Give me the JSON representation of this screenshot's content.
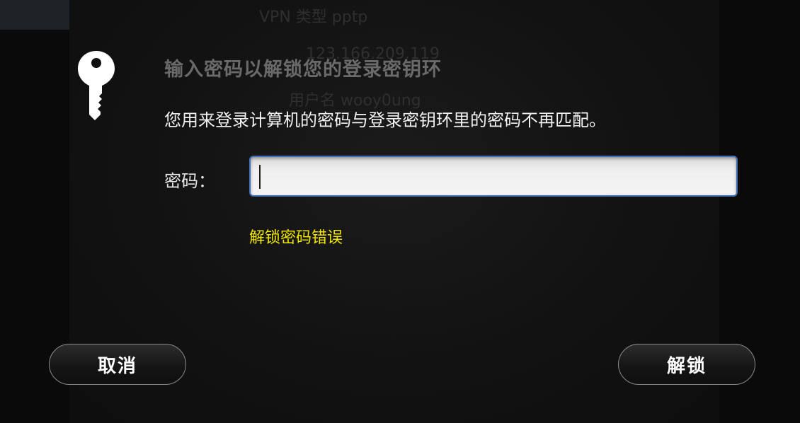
{
  "background": {
    "vpn_type_line": "VPN 类型 pptp",
    "address_line": "123.166.209.119",
    "username_line": "用户名 wooy0ung"
  },
  "dialog": {
    "icon": "key-icon",
    "title": "输入密码以解锁您的登录密钥环",
    "message": "您用来登录计算机的密码与登录密钥环里的密码不再匹配。",
    "password_label": "密码：",
    "password_value": "",
    "error_text": "解锁密码错误",
    "cancel_label": "取消",
    "unlock_label": "解锁"
  },
  "colors": {
    "error": "#f0e600",
    "input_border": "#3f6fb4",
    "title": "#6a6a6a"
  }
}
